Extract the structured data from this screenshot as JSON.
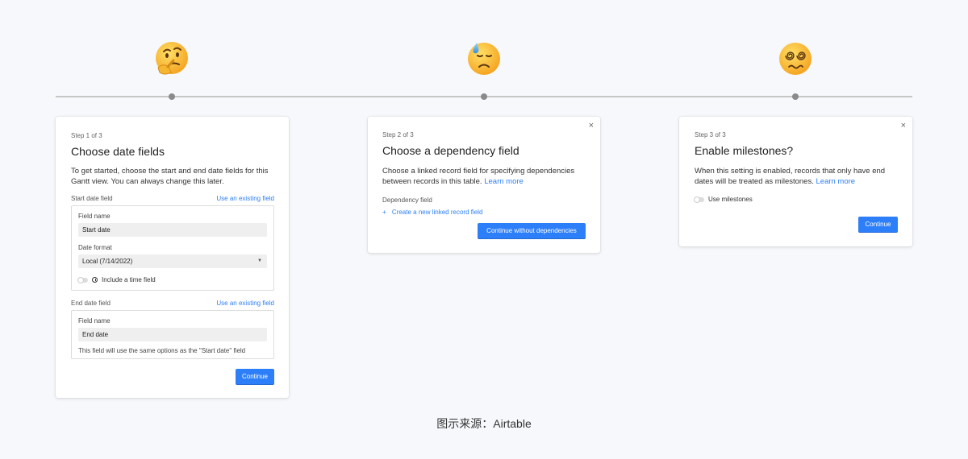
{
  "emojis": [
    {
      "name": "thinking-face-emoji"
    },
    {
      "name": "downcast-face-with-sweat-emoji"
    },
    {
      "name": "dizzy-face-emoji"
    }
  ],
  "colors": {
    "accent": "#2d7ff9",
    "background": "#f6f8fb",
    "timeline": "#c6c6c6",
    "timeline_dot": "#8a8a8a"
  },
  "step1": {
    "step": "Step 1 of 3",
    "title": "Choose date fields",
    "description": "To get started, choose the start and end date fields for this Gantt view. You can always change this later.",
    "start_label": "Start date field",
    "start_link": "Use an existing field",
    "start_field_name_label": "Field name",
    "start_field_name_value": "Start date",
    "date_format_label": "Date format",
    "date_format_value": "Local (7/14/2022)",
    "time_toggle_label": "Include a time field",
    "end_label": "End date field",
    "end_link": "Use an existing field",
    "end_field_name_label": "Field name",
    "end_field_name_value": "End date",
    "end_note": "This field will use the same options as the \"Start date\" field",
    "continue": "Continue"
  },
  "step2": {
    "close": "×",
    "step": "Step 2 of 3",
    "title": "Choose a dependency field",
    "description": "Choose a linked record field for specifying dependencies between records in this table.",
    "learn_more": "Learn more",
    "dependency_label": "Dependency field",
    "create_link_plus": "+",
    "create_link": "Create a new linked record field",
    "continue": "Continue without dependencies"
  },
  "step3": {
    "close": "×",
    "step": "Step 3 of 3",
    "title": "Enable milestones?",
    "description": "When this setting is enabled, records that only have end dates will be treated as milestones.",
    "learn_more": "Learn more",
    "toggle_label": "Use milestones",
    "continue": "Continue"
  },
  "caption": "图示来源：Airtable"
}
